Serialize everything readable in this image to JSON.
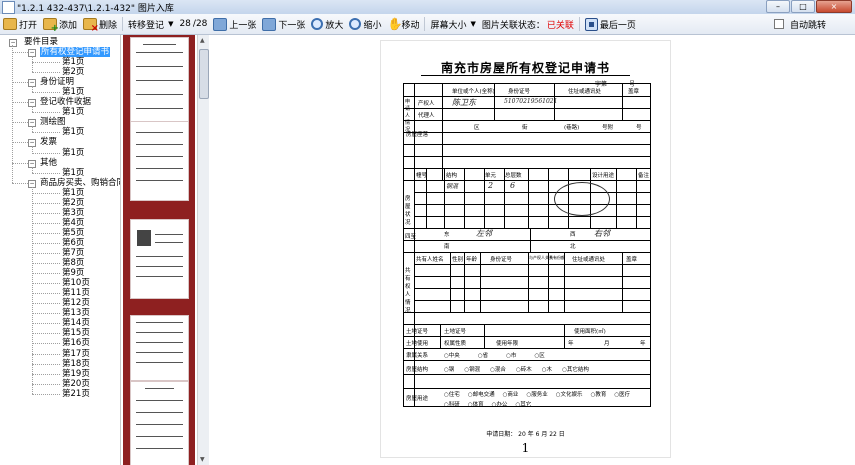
{
  "window": {
    "title": "\"1.2.1 432-437\\1.2.1-432\"  图片入库",
    "minimize": "–",
    "maximize": "□",
    "close": "×"
  },
  "toolbar": {
    "open": "打开",
    "add": "添加",
    "delete": "删除",
    "transfer": "转移登记",
    "page_current": "28",
    "page_total": "/28",
    "prev": "上一张",
    "next": "下一张",
    "zoom_in": "放大",
    "zoom_out": "缩小",
    "move": "移动",
    "screen_size": "屏幕大小",
    "link_status_label": "图片关联状态：",
    "link_status_value": "已关联",
    "last_page": "最后一页",
    "auto_jump": "自动跳转"
  },
  "tree": {
    "root": "要件目录",
    "groups": [
      {
        "label": "所有权登记申请书",
        "children": [
          "第1页",
          "第2页"
        ]
      },
      {
        "label": "身份证明",
        "children": [
          "第1页"
        ]
      },
      {
        "label": "登记收件收据",
        "children": [
          "第1页"
        ]
      },
      {
        "label": "测绘图",
        "children": [
          "第1页"
        ]
      },
      {
        "label": "发票",
        "children": [
          "第1页"
        ]
      },
      {
        "label": "其他",
        "children": [
          "第1页"
        ]
      },
      {
        "label": "商品房买卖、购销合同",
        "children": [
          "第1页",
          "第2页",
          "第3页",
          "第4页",
          "第5页",
          "第6页",
          "第7页",
          "第8页",
          "第9页",
          "第10页",
          "第11页",
          "第12页",
          "第13页",
          "第14页",
          "第15页",
          "第16页",
          "第17页",
          "第18页",
          "第19页",
          "第20页",
          "第21页"
        ]
      }
    ]
  },
  "document": {
    "title": "南充市房屋所有权登记申请书",
    "number_label": "字第",
    "number_suffix": "号",
    "rows": {
      "applicant": "申请人情况",
      "unit_name": "单位或个人(全称)",
      "id_no": "身份证号",
      "address": "住址或通讯处",
      "seal": "盖章",
      "owner": "产权人",
      "agent": "代理人",
      "location": "房屋座落",
      "district": "区",
      "street": "街",
      "lane": "(巷路)",
      "house_no": "号附",
      "no": "号",
      "building_no": "幢号",
      "structure": "结构",
      "floors": "总层数",
      "unit": "单元",
      "usage": "设计用途",
      "remarks": "备注",
      "status": "房屋状况",
      "neighbors": "四至",
      "east": "东",
      "west": "西",
      "south": "南",
      "north": "北",
      "co_owner": "共有权人情况",
      "co_name": "共有人姓名",
      "gender": "性别",
      "age": "年龄",
      "rel": "与产权人关系",
      "share": "共有份额",
      "land_no": "土地证号",
      "land_use_area": "使用面积(㎡)",
      "land_source": "土地使用",
      "land_nature": "权属性质",
      "use_years": "使用年限",
      "year": "年",
      "month": "月",
      "houses_type": "房屋结构",
      "house_use": "房屋用途",
      "org": "隶属关系"
    },
    "handwriting": {
      "owner_name": "陈卫东",
      "owner_id": "51070219561021",
      "struct_val": "钢混",
      "floors_val": "6",
      "unit_val": "2",
      "east_val": "左邻",
      "west_val": "右邻"
    },
    "options_affiliation": [
      "○中央",
      "○省",
      "○市",
      "○区"
    ],
    "options_structure": [
      "○钢",
      "○钢混",
      "○混合",
      "○砖木",
      "○木",
      "○其它结构"
    ],
    "options_use": [
      "○住宅",
      "○邮电交通",
      "○商业",
      "○服务业",
      "○文化娱乐",
      "○教育",
      "○医疗",
      "○科研",
      "○体育",
      "○办公",
      "○其它"
    ],
    "date_line": "申请日期：  20 年  6 月  22 日",
    "page_mark": "1"
  }
}
